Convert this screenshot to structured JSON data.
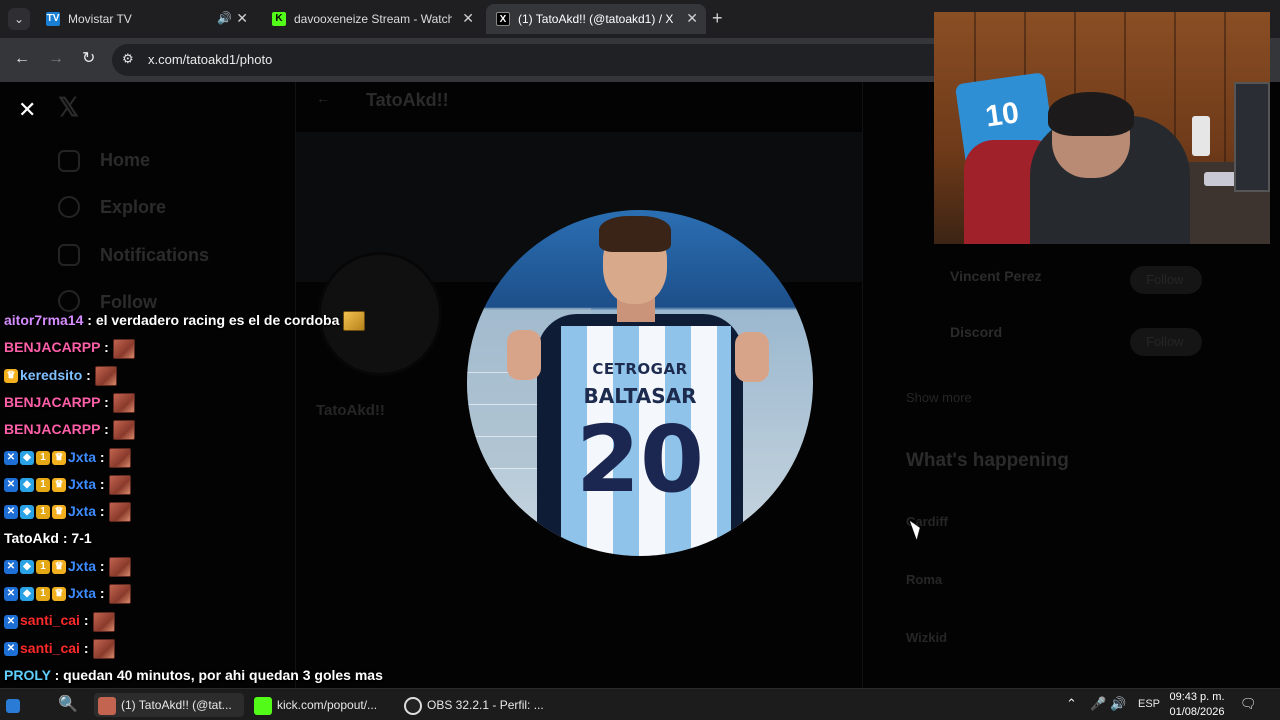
{
  "browser": {
    "tabs": [
      {
        "title": "Movistar TV",
        "favicon": "movistar-tv-icon",
        "audio": true
      },
      {
        "title": "davooxeneize Stream - Watch L",
        "favicon": "kick-logo-icon"
      },
      {
        "title": "(1) TatoAkd!! (@tatoakd1) / X",
        "favicon": "x-logo-icon",
        "active": true
      }
    ],
    "url": "x.com/tatoakd1/photo"
  },
  "twitter_background": {
    "nav": [
      "Home",
      "Explore",
      "Notifications",
      "Follow"
    ],
    "profile_name": "TatoAkd!!",
    "who_to_follow": [
      {
        "name": "Vincent Perez",
        "button": "Follow"
      },
      {
        "name": "Discord",
        "button": "Follow"
      }
    ],
    "show_more": "Show more",
    "whats_happening_title": "What's happening",
    "trends": [
      "Cardiff",
      "Roma",
      "Wizkid"
    ]
  },
  "photo": {
    "sponsor": "CETROGAR",
    "player_name": "BALTASAR",
    "shirt_number": "20"
  },
  "webcam": {
    "shirt_number": "10"
  },
  "chat": [
    {
      "user": "aitor7rma14",
      "color": "#d58cff",
      "text": " : el verdadero racing es el de cordoba",
      "badges": [],
      "emote": "gold"
    },
    {
      "user": "BENJACARPP",
      "color": "#ff5fa8",
      "text": " :",
      "badges": [],
      "emote": "face"
    },
    {
      "user": "keredsito",
      "color": "#7fc0ff",
      "text": " :",
      "badges": [
        "crown"
      ],
      "emote": "face"
    },
    {
      "user": "BENJACARPP",
      "color": "#ff5fa8",
      "text": " :",
      "badges": [],
      "emote": "face"
    },
    {
      "user": "BENJACARPP",
      "color": "#ff5fa8",
      "text": " :",
      "badges": [],
      "emote": "face"
    },
    {
      "user": "Jxta",
      "color": "#3c8cff",
      "text": " :",
      "badges": [
        "x",
        "cube",
        "coin",
        "crown"
      ],
      "emote": "face"
    },
    {
      "user": "Jxta",
      "color": "#3c8cff",
      "text": " :",
      "badges": [
        "x",
        "cube",
        "coin",
        "crown"
      ],
      "emote": "face"
    },
    {
      "user": "Jxta",
      "color": "#3c8cff",
      "text": " :",
      "badges": [
        "x",
        "cube",
        "coin",
        "crown"
      ],
      "emote": "face"
    },
    {
      "user": "TatoAkd",
      "color": "#ffffff",
      "text": " : 7-1",
      "badges": [],
      "emote": null
    },
    {
      "user": "Jxta",
      "color": "#3c8cff",
      "text": " :",
      "badges": [
        "x",
        "cube",
        "coin",
        "crown"
      ],
      "emote": "face"
    },
    {
      "user": "Jxta",
      "color": "#3c8cff",
      "text": " :",
      "badges": [
        "x",
        "cube",
        "coin",
        "crown"
      ],
      "emote": "face"
    },
    {
      "user": "santi_cai",
      "color": "#ff2a2a",
      "text": " :",
      "badges": [
        "x"
      ],
      "emote": "face"
    },
    {
      "user": "santi_cai",
      "color": "#ff2a2a",
      "text": " :",
      "badges": [
        "x"
      ],
      "emote": "face"
    },
    {
      "user": "PROLY",
      "color": "#5fd0ff",
      "text": " : quedan 40 minutos, por ahi quedan 3 goles mas",
      "badges": [],
      "emote": null
    },
    {
      "user": "santi_cai",
      "color": "#ff2a2a",
      "text": " :",
      "badges": [
        "x"
      ],
      "emote": null
    }
  ],
  "taskbar": {
    "items": [
      {
        "label": "(1) TatoAkd!! (@tat...",
        "icon": "chrome-icon"
      },
      {
        "label": "kick.com/popout/...",
        "icon": "kick-logo-icon"
      },
      {
        "label": "OBS 32.2.1 - Perfil: ...",
        "icon": "obs-icon"
      }
    ],
    "lang": "ESP",
    "time": "09:43 p. m.",
    "date": "01/08/2026"
  },
  "colors": {
    "x_blue": "#1d9bf0",
    "kick_green": "#53fc18",
    "tab_active": "#35363a"
  }
}
